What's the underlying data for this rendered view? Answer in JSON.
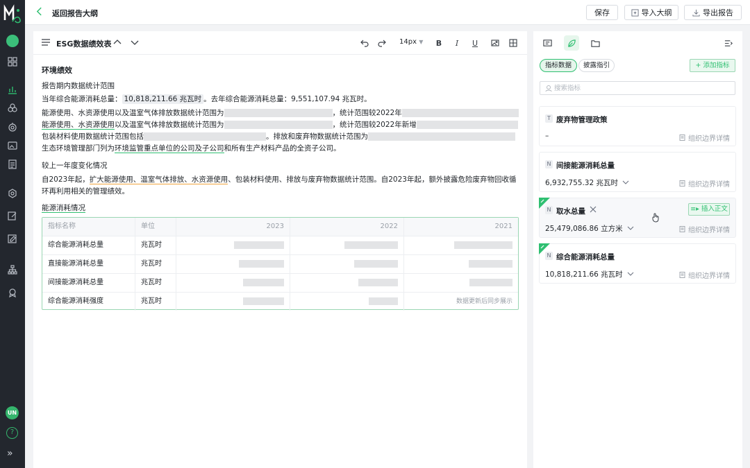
{
  "nav": {
    "user_initials": "UN",
    "help_glyph": "?",
    "expand_glyph": "»"
  },
  "topbar": {
    "back_label": "返回报告大纲",
    "save_label": "保存",
    "import_label": "导入大纲",
    "export_label": "导出报告"
  },
  "editor": {
    "doc_title": "ESG数据绩效表",
    "font_size": "14px",
    "bold_glyph": "B",
    "italic_glyph": "I",
    "underline_glyph": "U",
    "section_title": "环境绩效",
    "scope_heading": "报告期内数据统计范围",
    "energy_line_prefix": "当年综合能源消耗总量：",
    "energy_line_value": "10,818,211.66 兆瓦时",
    "energy_line_suffix": "。去年综合能源消耗总量：9,551,107.94 兆瓦时。",
    "scope_line1_a": "能源使用、水资源使用以及温室气体排放数据统计范围为",
    "scope_line1_b": "，统计范围较2022年",
    "scope_line2_a": "能源使用、水资源使用",
    "scope_line2_b": "以及温室气体排放数据统计范围为",
    "scope_line2_c": "，统计范围较2022年新增",
    "scope_line3_a": "包装材料使用数据统计范围包括",
    "scope_line3_b": "。排放和废弃物数据统计范围为",
    "scope_line4_a": "生态环境管理部门列为",
    "scope_line4_b": "环境监管重点单位的公司及子公司",
    "scope_line4_c": "和所有生产材料产品的全资子公司。",
    "change_heading": "较上一年度变化情况",
    "change_line1_a": "自2023年起，",
    "change_line1_b": "扩大能源使用、温室气体排放、水资源使用",
    "change_line1_c": "、包装材料使用、排放与废弃物数据统计范围。自2023年起，额外披露危险废弃物回收循",
    "change_line2": "环再利用相关的管理绩效。",
    "table_heading": "能源消耗情况",
    "table": {
      "columns": [
        "指标名称",
        "单位",
        "2023",
        "2022",
        "2021"
      ],
      "rows": [
        {
          "name": "综合能源消耗总量",
          "unit": "兆瓦时"
        },
        {
          "name": "直接能源消耗总量",
          "unit": "兆瓦时"
        },
        {
          "name": "间接能源消耗总量",
          "unit": "兆瓦时"
        },
        {
          "name": "综合能源消耗强度",
          "unit": "兆瓦时",
          "note": "数据更新后同步展示"
        }
      ]
    }
  },
  "side": {
    "seg_metrics": "指标数据",
    "seg_guide": "披露指引",
    "add_metric": "+ 添加指标",
    "search_placeholder": "搜索指标",
    "insert_label": "插入正文",
    "detail_label": "组织边界详情",
    "cards": [
      {
        "badge": "T",
        "name": "废弃物管理政策",
        "value": "–"
      },
      {
        "badge": "N",
        "name": "间接能源消耗总量",
        "value": "6,932,755.32 兆瓦时"
      },
      {
        "badge": "N",
        "name": "取水总量",
        "value": "25,479,086.86 立方米"
      },
      {
        "badge": "N",
        "name": "综合能源消耗总量",
        "value": "10,818,211.66 兆瓦时"
      }
    ]
  },
  "colors": {
    "accent": "#2fbf71",
    "rail": "#23272e",
    "placeholder": "#e3e4e6"
  },
  "icons": [
    "logo-icon",
    "home-icon",
    "grid-icon",
    "chart-icon",
    "users-icon",
    "target-icon",
    "image-icon",
    "doc-icon",
    "settings-icon",
    "edit-icon",
    "note-icon",
    "tree-icon",
    "badge-icon",
    "menu-icon",
    "chevron-up-icon",
    "chevron-down-icon",
    "undo-icon",
    "redo-icon",
    "image-insert-icon",
    "table-insert-icon",
    "comment-icon",
    "leaf-icon",
    "folder-icon",
    "collapse-panel-icon",
    "search-icon",
    "link-icon",
    "close-icon",
    "cursor-icon"
  ]
}
